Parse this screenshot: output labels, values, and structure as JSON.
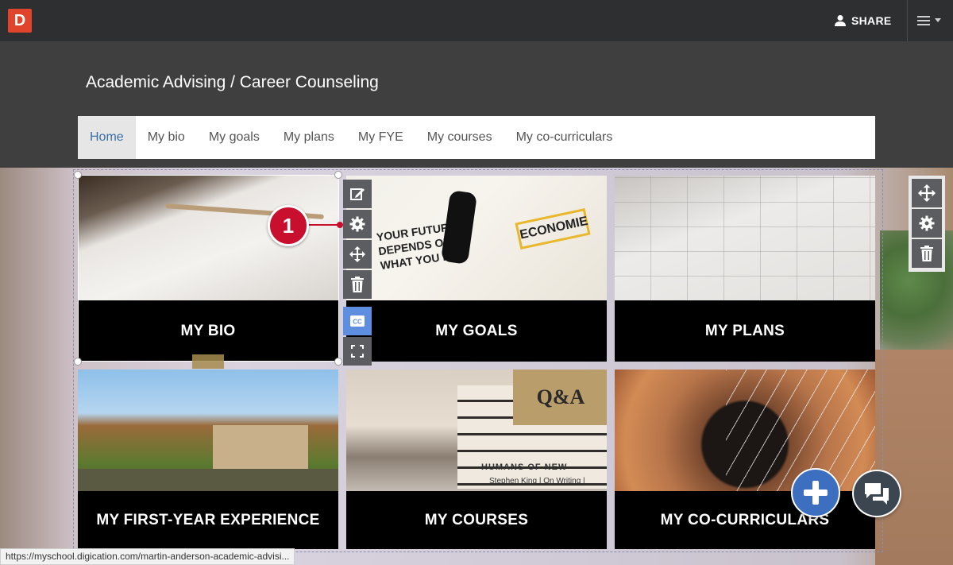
{
  "app": {
    "logo_letter": "D",
    "share_label": "SHARE",
    "brand_color": "#e0452b"
  },
  "page": {
    "title": "Academic Advising / Career Counseling"
  },
  "nav": {
    "items": [
      {
        "label": "Home",
        "active": true
      },
      {
        "label": "My bio",
        "active": false
      },
      {
        "label": "My goals",
        "active": false
      },
      {
        "label": "My plans",
        "active": false
      },
      {
        "label": "My FYE",
        "active": false
      },
      {
        "label": "My courses",
        "active": false
      },
      {
        "label": "My co-curriculars",
        "active": false
      }
    ]
  },
  "tiles": [
    {
      "caption": "MY BIO",
      "image_icon": "notebook-pencil-image"
    },
    {
      "caption": "MY GOALS",
      "image_icon": "goals-notes-image"
    },
    {
      "caption": "MY PLANS",
      "image_icon": "planner-calendar-image"
    },
    {
      "caption": "MY FIRST-YEAR EXPERIENCE",
      "image_icon": "college-bridge-image"
    },
    {
      "caption": "MY COURSES",
      "image_icon": "book-stack-image"
    },
    {
      "caption": "MY CO-CURRICULARS",
      "image_icon": "guitar-image"
    }
  ],
  "images": {
    "goals_text": "YOUR FUTURE DEPENDS ON WHAT YOU DO",
    "goals_sticker": "ECONOMIE",
    "courses_box": "Q&A",
    "courses_book1": "HUMANS OF NEW",
    "courses_book2": "Stephen King | On Writing |"
  },
  "tile_toolbar": {
    "buttons": [
      "edit-icon",
      "gear-icon",
      "move-icon",
      "trash-icon",
      "closed-caption-icon",
      "fullscreen-icon"
    ],
    "cc_color": "#5d8ee0"
  },
  "section_toolbar": {
    "buttons": [
      "move-icon",
      "gear-icon",
      "trash-icon"
    ]
  },
  "callout": {
    "number": "1",
    "color": "#c8102e"
  },
  "status_bar": {
    "url": "https://myschool.digication.com/martin-anderson-academic-advisi..."
  }
}
